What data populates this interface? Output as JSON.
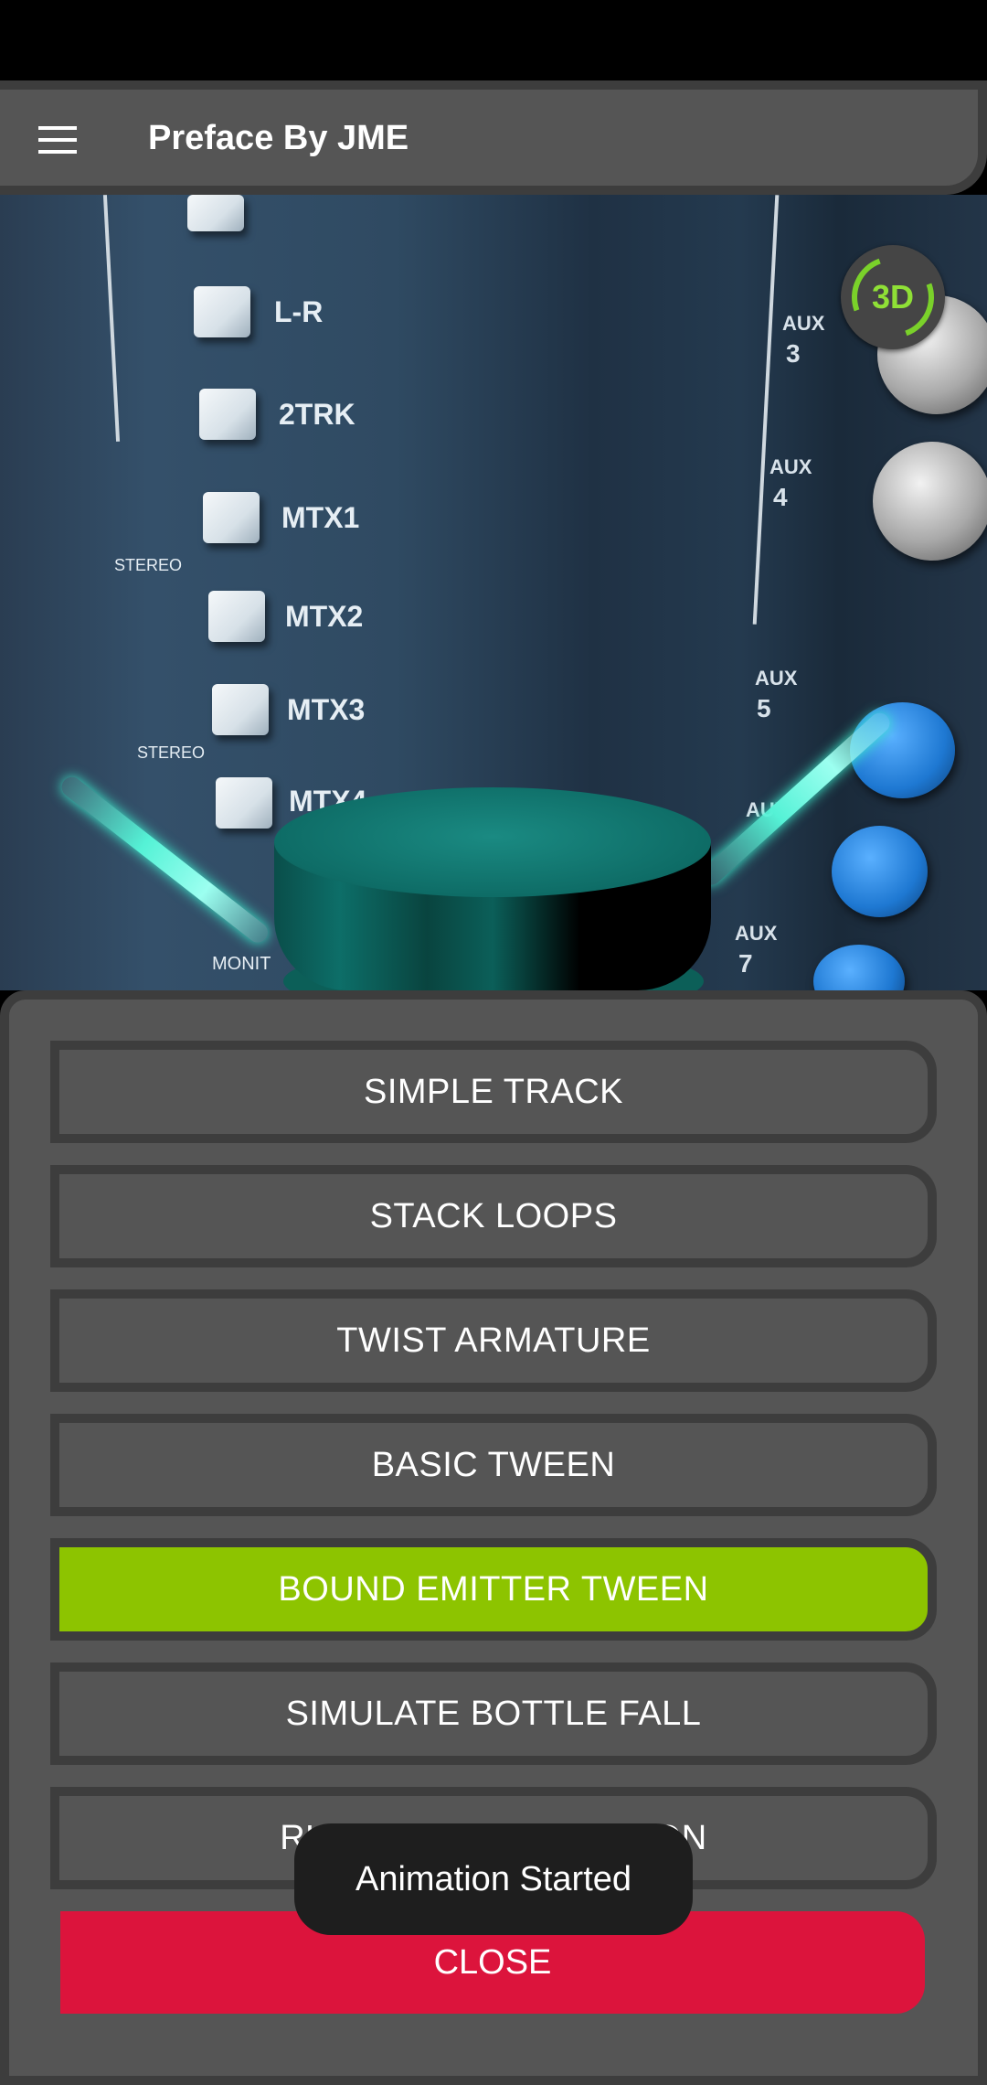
{
  "toolbar": {
    "menu_icon": "hamburger-menu-icon",
    "title": "Preface By JME"
  },
  "camera": {
    "keys": [
      "L-R",
      "2TRK",
      "MTX1",
      "MTX2",
      "MTX3",
      "MTX4"
    ],
    "aux_labels": [
      "AUX",
      "3",
      "AUX",
      "4",
      "AUX",
      "5",
      "AUX",
      "AUX",
      "7"
    ],
    "side_labels": [
      "STEREO",
      "STEREO",
      "MONIT"
    ],
    "badge": "3D"
  },
  "menu": {
    "buttons": [
      {
        "label": "SIMPLE TRACK",
        "active": false
      },
      {
        "label": "STACK LOOPS",
        "active": false
      },
      {
        "label": "TWIST ARMATURE",
        "active": false
      },
      {
        "label": "BASIC TWEEN",
        "active": false
      },
      {
        "label": "BOUND EMITTER TWEEN",
        "active": true
      },
      {
        "label": "SIMULATE BOTTLE FALL",
        "active": false
      },
      {
        "label": "RUN BOTTLE ANIMATION",
        "active": false
      }
    ],
    "close_label": "CLOSE"
  },
  "toast": {
    "message": "Animation Started"
  },
  "colors": {
    "toolbar_bg": "#555555",
    "border": "#3d3d3d",
    "active_button": "#8dc400",
    "close_button": "#dc143c",
    "badge_accent": "#7ad12a"
  }
}
